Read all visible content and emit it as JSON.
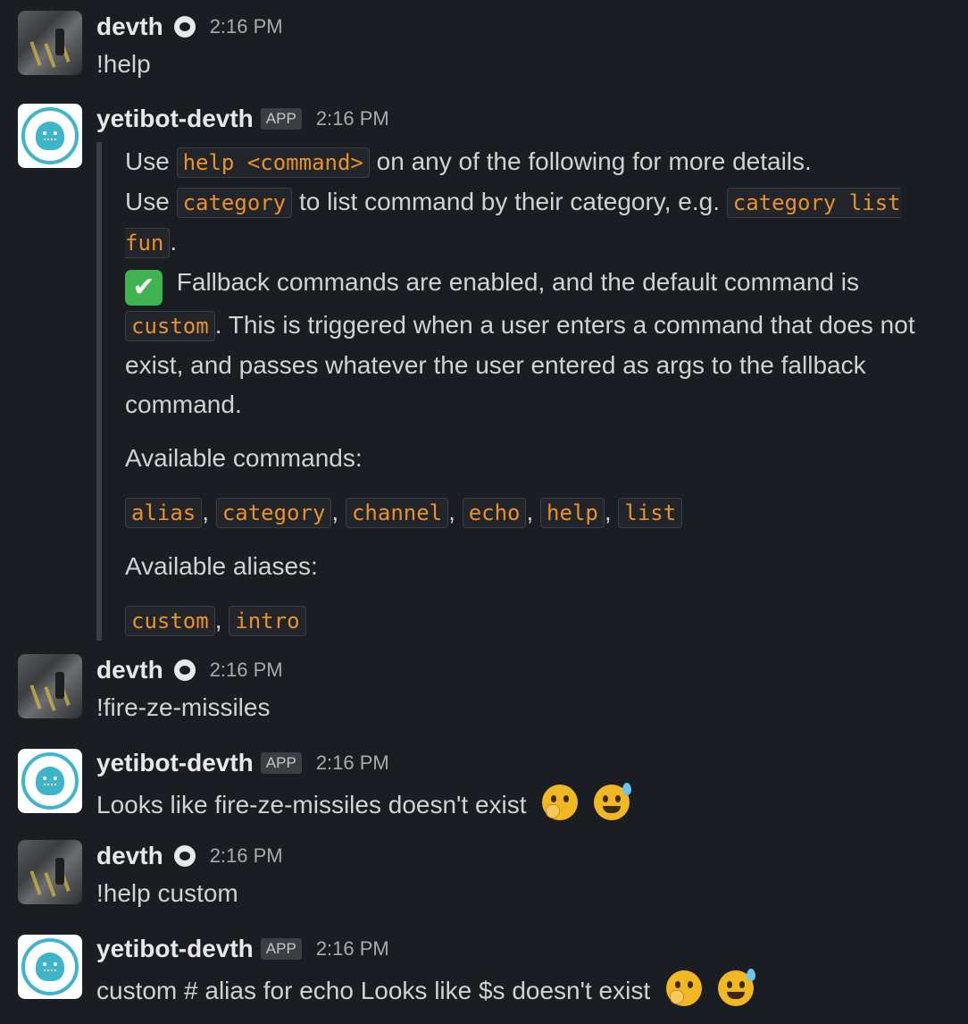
{
  "messages": [
    {
      "author": "devth",
      "status_icon": "smiley-status-icon",
      "time": "2:16 PM",
      "text": "!help"
    },
    {
      "author": "yetibot-devth",
      "badge": "APP",
      "time": "2:16 PM",
      "help": {
        "line1_pre": "Use ",
        "line1_code": "help <command>",
        "line1_post": " on any of the following for more details.",
        "line2_pre": "Use ",
        "line2_code": "category",
        "line2_mid": " to list command by their category,  e.g. ",
        "line2_code2": "category list fun",
        "line2_post": ".",
        "fallback_text": " Fallback commands are enabled, and the default command is ",
        "fallback_code": "custom",
        "fallback_post": ". This is triggered when a user enters a command that does not exist, and passes whatever the user entered as args to the fallback command.",
        "commands_label": "Available commands:",
        "commands": [
          "alias",
          "category",
          "channel",
          "echo",
          "help",
          "list"
        ],
        "aliases_label": "Available aliases:",
        "aliases": [
          "custom",
          "intro"
        ]
      }
    },
    {
      "author": "devth",
      "status_icon": "smiley-status-icon",
      "time": "2:16 PM",
      "text": "!fire-ze-missiles"
    },
    {
      "author": "yetibot-devth",
      "badge": "APP",
      "time": "2:16 PM",
      "text": "Looks like fire-ze-missiles doesn't exist"
    },
    {
      "author": "devth",
      "status_icon": "smiley-status-icon",
      "time": "2:16 PM",
      "text": "!help custom"
    },
    {
      "author": "yetibot-devth",
      "badge": "APP",
      "time": "2:16 PM",
      "text": "custom # alias for echo Looks like $s doesn't exist"
    }
  ],
  "emojis": {
    "thinking": "thinking-face-emoji",
    "sweat_smile": "sweat-smile-emoji",
    "check": "white-check-mark-emoji"
  },
  "colors": {
    "background": "#1a1d21",
    "code_text": "#e8912d",
    "app_badge_bg": "#3b3e42",
    "bot_accent": "#3fb5c9"
  }
}
